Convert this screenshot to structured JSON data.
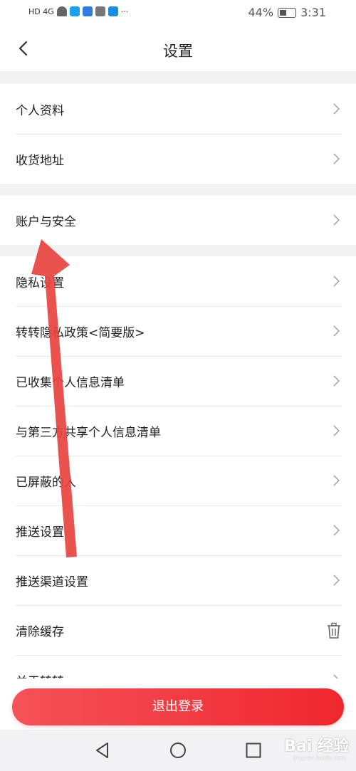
{
  "status_bar": {
    "network_text": "HD 4G",
    "battery_percent": "44%",
    "battery_level": 0.44,
    "time": "3:31",
    "more": "···"
  },
  "header": {
    "title": "设置"
  },
  "groups": [
    {
      "items": [
        {
          "label": "个人资料"
        },
        {
          "label": "收货地址"
        }
      ]
    },
    {
      "items": [
        {
          "label": "账户与安全"
        }
      ]
    },
    {
      "items": [
        {
          "label": "隐私设置"
        },
        {
          "label": "转转隐私政策<简要版>"
        },
        {
          "label": "已收集个人信息清单"
        },
        {
          "label": "与第三方共享个人信息清单"
        },
        {
          "label": "已屏蔽的人"
        },
        {
          "label": "推送设置"
        },
        {
          "label": "推送渠道设置"
        },
        {
          "label": "清除缓存"
        },
        {
          "label": "关于转转"
        }
      ]
    }
  ],
  "logout_button": {
    "label": "退出登录"
  },
  "watermark": {
    "text": "Bai 经验",
    "sub": "jingyan.baidu.com"
  },
  "colors": {
    "accent": "#f0262e",
    "arrow": "#e8433f"
  },
  "icons": {
    "back": "chevron-left-icon",
    "chevron": "chevron-right-icon",
    "cache": "trash-icon",
    "sys_back": "triangle-back-icon",
    "sys_home": "circle-home-icon",
    "sys_recent": "square-recent-icon"
  }
}
